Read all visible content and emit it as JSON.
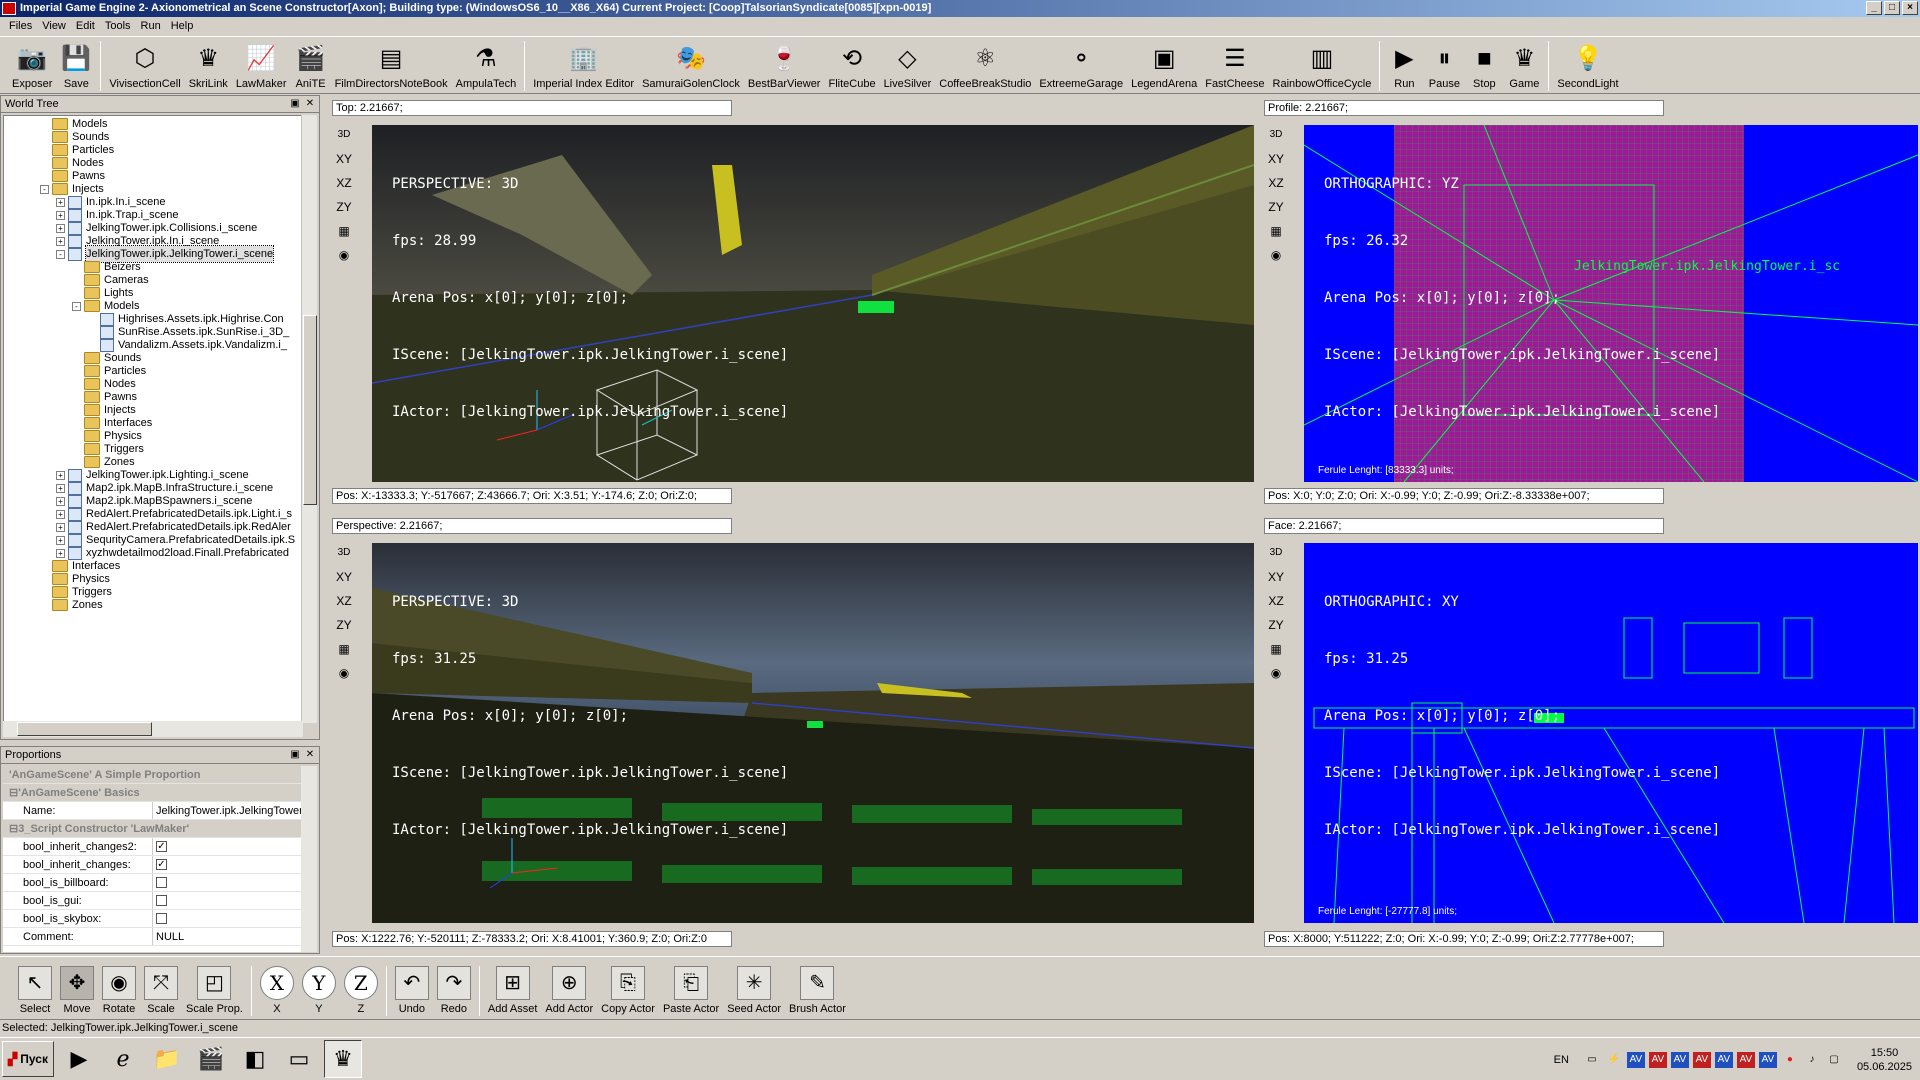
{
  "window": {
    "title": "Imperial Game Engine 2- Axionometrical an Scene Constructor[Axon]; Building type: (WindowsOS6_10__X86_X64) Current Project: [Coop]TalsorianSyndicate[0085][xpn-0019]"
  },
  "menu": [
    "Files",
    "View",
    "Edit",
    "Tools",
    "Run",
    "Help"
  ],
  "toolbar": [
    {
      "label": "Exposer",
      "icon": "camera-box-icon"
    },
    {
      "label": "Save",
      "icon": "floppy-icon"
    },
    {
      "label": "VivisectionCell",
      "icon": "cube-icon"
    },
    {
      "label": "SkriLink",
      "icon": "eagle-icon"
    },
    {
      "label": "LawMaker",
      "icon": "chart-icon"
    },
    {
      "label": "AniTE",
      "icon": "clapper-icon"
    },
    {
      "label": "FilmDirectorsNoteBook",
      "icon": "notebook-icon"
    },
    {
      "label": "AmpulaTech",
      "icon": "ampule-icon"
    },
    {
      "label": "Imperial Index Editor",
      "icon": "building-icon"
    },
    {
      "label": "SamuraiGolenClock",
      "icon": "masks-icon"
    },
    {
      "label": "BestBarViewer",
      "icon": "bottle-icon"
    },
    {
      "label": "FliteCube",
      "icon": "loop-icon"
    },
    {
      "label": "LiveSilver",
      "icon": "diamond-icon"
    },
    {
      "label": "CoffeeBreakStudio",
      "icon": "molecule-icon"
    },
    {
      "label": "ExtreemeGarage",
      "icon": "spheres-icon"
    },
    {
      "label": "LegendArena",
      "icon": "arena-icon"
    },
    {
      "label": "FastCheese",
      "icon": "sliders-icon"
    },
    {
      "label": "RainbowOfficeCycle",
      "icon": "rainbow-bars-icon"
    },
    {
      "label": "Run",
      "icon": "run-icon"
    },
    {
      "label": "Pause",
      "icon": "pause-icon"
    },
    {
      "label": "Stop",
      "icon": "stop-icon"
    },
    {
      "label": "Game",
      "icon": "eagle-icon"
    },
    {
      "label": "SecondLight",
      "icon": "lamp-icon"
    }
  ],
  "world_tree": {
    "title": "World Tree",
    "items": [
      {
        "label": "Models",
        "kind": "folder",
        "depth": 3
      },
      {
        "label": "Sounds",
        "kind": "folder",
        "depth": 3
      },
      {
        "label": "Particles",
        "kind": "folder",
        "depth": 3
      },
      {
        "label": "Nodes",
        "kind": "folder",
        "depth": 3
      },
      {
        "label": "Pawns",
        "kind": "folder",
        "depth": 3
      },
      {
        "label": "Injects",
        "kind": "folder",
        "depth": 3,
        "exp": "-"
      },
      {
        "label": "In.ipk.In.i_scene",
        "kind": "scene",
        "depth": 4,
        "exp": "+"
      },
      {
        "label": "In.ipk.Trap.i_scene",
        "kind": "scene",
        "depth": 4,
        "exp": "+"
      },
      {
        "label": "JelkingTower.ipk.Collisions.i_scene",
        "kind": "scene",
        "depth": 4,
        "exp": "+"
      },
      {
        "label": "JelkingTower.ipk.In.i_scene",
        "kind": "scene",
        "depth": 4,
        "exp": "+"
      },
      {
        "label": "JelkingTower.ipk.JelkingTower.i_scene",
        "kind": "scene",
        "depth": 4,
        "exp": "-",
        "selected": true
      },
      {
        "label": "Beizers",
        "kind": "folder",
        "depth": 5
      },
      {
        "label": "Cameras",
        "kind": "folder",
        "depth": 5
      },
      {
        "label": "Lights",
        "kind": "folder",
        "depth": 5
      },
      {
        "label": "Models",
        "kind": "folder",
        "depth": 5,
        "exp": "-"
      },
      {
        "label": "Highrises.Assets.ipk.Highrise.Con",
        "kind": "scene",
        "depth": 6
      },
      {
        "label": "SunRise.Assets.ipk.SunRise.i_3D_",
        "kind": "scene",
        "depth": 6
      },
      {
        "label": "Vandalizm.Assets.ipk.Vandalizm.i_",
        "kind": "scene",
        "depth": 6
      },
      {
        "label": "Sounds",
        "kind": "folder",
        "depth": 5
      },
      {
        "label": "Particles",
        "kind": "folder",
        "depth": 5
      },
      {
        "label": "Nodes",
        "kind": "folder",
        "depth": 5
      },
      {
        "label": "Pawns",
        "kind": "folder",
        "depth": 5
      },
      {
        "label": "Injects",
        "kind": "folder",
        "depth": 5
      },
      {
        "label": "Interfaces",
        "kind": "folder",
        "depth": 5
      },
      {
        "label": "Physics",
        "kind": "folder",
        "depth": 5
      },
      {
        "label": "Triggers",
        "kind": "folder",
        "depth": 5
      },
      {
        "label": "Zones",
        "kind": "folder",
        "depth": 5
      },
      {
        "label": "JelkingTower.ipk.Lighting.i_scene",
        "kind": "scene",
        "depth": 4,
        "exp": "+"
      },
      {
        "label": "Map2.ipk.MapB.InfraStructure.i_scene",
        "kind": "scene",
        "depth": 4,
        "exp": "+"
      },
      {
        "label": "Map2.ipk.MapBSpawners.i_scene",
        "kind": "scene",
        "depth": 4,
        "exp": "+"
      },
      {
        "label": "RedAlert.PrefabricatedDetails.ipk.Light.i_s",
        "kind": "scene",
        "depth": 4,
        "exp": "+"
      },
      {
        "label": "RedAlert.PrefabricatedDetails.ipk.RedAler",
        "kind": "scene",
        "depth": 4,
        "exp": "+"
      },
      {
        "label": "SequrityCamera.PrefabricatedDetails.ipk.S",
        "kind": "scene",
        "depth": 4,
        "exp": "+"
      },
      {
        "label": "xyzhwdetailmod2load.Finall.Prefabricated",
        "kind": "scene",
        "depth": 4,
        "exp": "+"
      },
      {
        "label": "Interfaces",
        "kind": "folder",
        "depth": 3
      },
      {
        "label": "Physics",
        "kind": "folder",
        "depth": 3
      },
      {
        "label": "Triggers",
        "kind": "folder",
        "depth": 3
      },
      {
        "label": "Zones",
        "kind": "folder",
        "depth": 3
      }
    ]
  },
  "proportions": {
    "title": "Proportions",
    "rows": [
      {
        "type": "group",
        "text": "'AnGameScene' A Simple Proportion"
      },
      {
        "type": "group",
        "text": "'AnGameScene' Basics",
        "exp": "-"
      },
      {
        "type": "field",
        "key": "Name:",
        "value": "JelkingTower.ipk.JelkingTower.i"
      },
      {
        "type": "group",
        "text": "3_Script Constructor 'LawMaker'",
        "exp": "-"
      },
      {
        "type": "check",
        "key": "bool_inherit_changes2:",
        "checked": true
      },
      {
        "type": "check",
        "key": "bool_inherit_changes:",
        "checked": true
      },
      {
        "type": "check",
        "key": "bool_is_billboard:",
        "checked": false
      },
      {
        "type": "check",
        "key": "bool_is_gui:",
        "checked": false
      },
      {
        "type": "check",
        "key": "bool_is_skybox:",
        "checked": false
      },
      {
        "type": "field",
        "key": "Comment:",
        "value": "NULL"
      }
    ]
  },
  "viewports": {
    "top": {
      "header": "Top: 2.21667;",
      "hud": [
        "PERSPECTIVE: 3D",
        "fps: 28.99",
        "Arena Pos: x[0]; y[0]; z[0];",
        "IScene: [JelkingTower.ipk.JelkingTower.i_scene]",
        "IActor: [JelkingTower.ipk.JelkingTower.i_scene]"
      ],
      "footer": "Pos: X:-13333.3; Y:-517667; Z:43666.7; Ori: X:3.51; Y:-174.6; Z:0; Ori:Z:0;"
    },
    "profile": {
      "header": "Profile: 2.21667;",
      "hud": [
        "ORTHOGRAPHIC: YZ",
        "fps: 26.32",
        "Arena Pos: x[0]; y[0]; z[0];",
        "IScene: [JelkingTower.ipk.JelkingTower.i_scene]",
        "IActor: [JelkingTower.ipk.JelkingTower.i_scene]"
      ],
      "label_in_view": "JelkingTower.ipk.JelkingTower.i_sc",
      "ferule": "Ferule Lenght: [83333.3] units;",
      "footer": "Pos: X:0; Y:0; Z:0; Ori: X:-0.99; Y:0; Z:-0.99; Ori:Z:-8.33338e+007;"
    },
    "perspective": {
      "header": "Perspective: 2.21667;",
      "hud": [
        "PERSPECTIVE: 3D",
        "fps: 31.25",
        "Arena Pos: x[0]; y[0]; z[0];",
        "IScene: [JelkingTower.ipk.JelkingTower.i_scene]",
        "IActor: [JelkingTower.ipk.JelkingTower.i_scene]"
      ],
      "footer": "Pos: X:1222.76; Y:-520111; Z:-78333.2; Ori: X:8.41001; Y:360.9; Z:0; Ori:Z:0"
    },
    "face": {
      "header": "Face: 2.21667;",
      "hud": [
        "ORTHOGRAPHIC: XY",
        "fps: 31.25",
        "Arena Pos: x[0]; y[0]; z[0];",
        "IScene: [JelkingTower.ipk.JelkingTower.i_scene]",
        "IActor: [JelkingTower.ipk.JelkingTower.i_scene]"
      ],
      "ferule": "Ferule Lenght: [-27777.8] units;",
      "footer": "Pos: X:8000; Y:511222; Z:0; Ori: X:-0.99; Y:0; Z:-0.99; Ori:Z:2.77778e+007;"
    },
    "side_buttons": [
      "3D",
      "XY",
      "XZ",
      "ZY"
    ]
  },
  "tools": [
    {
      "label": "Select",
      "icon": "cursor-icon"
    },
    {
      "label": "Move",
      "icon": "move-axes-icon"
    },
    {
      "label": "Rotate",
      "icon": "rotate-sphere-icon"
    },
    {
      "label": "Scale",
      "icon": "scale-icon"
    },
    {
      "label": "Scale Prop.",
      "icon": "scale-prop-icon"
    },
    {
      "label": "X",
      "icon": "axis-x-icon",
      "glyph": "X"
    },
    {
      "label": "Y",
      "icon": "axis-y-icon",
      "glyph": "Y"
    },
    {
      "label": "Z",
      "icon": "axis-z-icon",
      "glyph": "Z"
    },
    {
      "label": "Undo",
      "icon": "undo-icon"
    },
    {
      "label": "Redo",
      "icon": "redo-icon"
    },
    {
      "label": "Add Asset",
      "icon": "add-asset-icon"
    },
    {
      "label": "Add Actor",
      "icon": "add-actor-icon"
    },
    {
      "label": "Copy Actor",
      "icon": "copy-actor-icon"
    },
    {
      "label": "Paste Actor",
      "icon": "paste-actor-icon"
    },
    {
      "label": "Seed Actor",
      "icon": "seed-actor-icon"
    },
    {
      "label": "Brush Actor",
      "icon": "brush-actor-icon"
    }
  ],
  "status": "Selected: JelkingTower.ipk.JelkingTower.i_scene",
  "taskbar": {
    "start_label": "Пуск",
    "lang": "EN",
    "time": "15:50",
    "date": "05.06.2025",
    "apps": [
      "media-player-icon",
      "ie-icon",
      "explorer-icon",
      "clapper-icon",
      "window-icon",
      "terminal-icon",
      "eagle-icon"
    ]
  },
  "colors": {
    "titlebar": "#0a246a",
    "ortho_bg": "#0000ff",
    "grid_magenta": "#a01898",
    "wire_green": "#00ff40"
  }
}
